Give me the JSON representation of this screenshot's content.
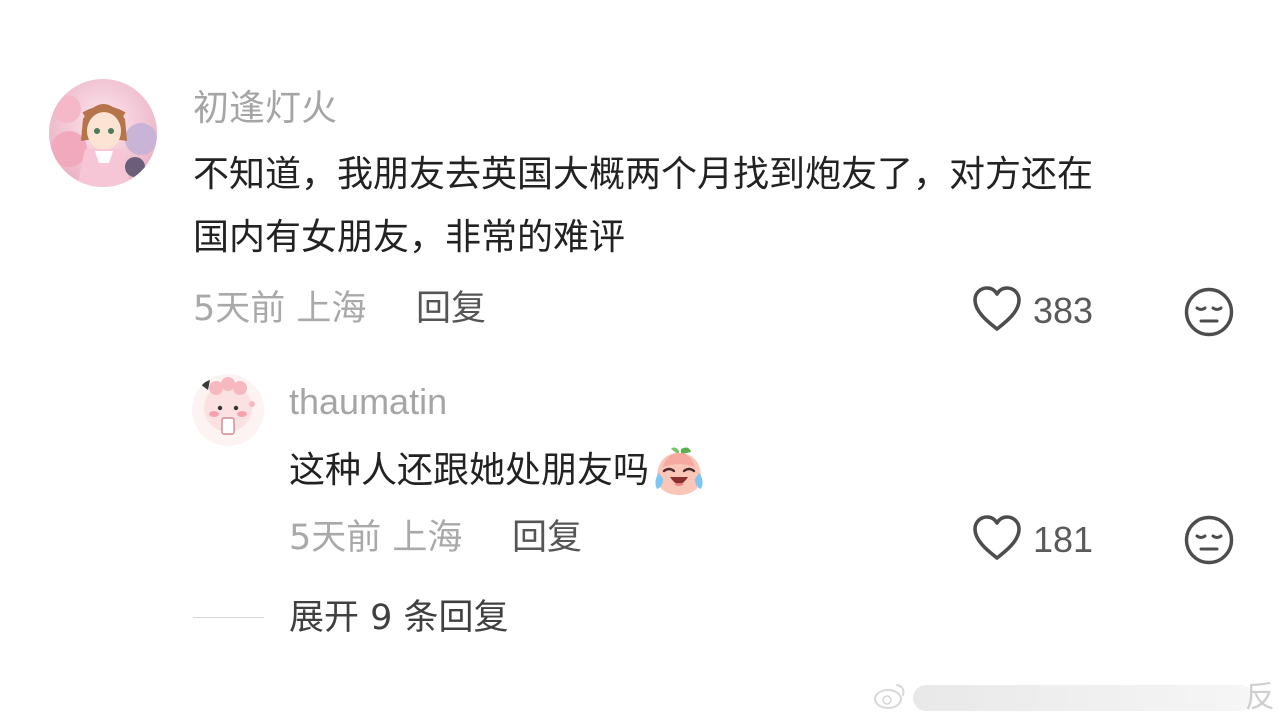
{
  "comments": [
    {
      "username": "初逢灯火",
      "text_lines": [
        "不知道，我朋友去英国大概两个月找到炮友了，对方还在",
        "国内有女朋友，非常的难评"
      ],
      "meta": "5天前 上海",
      "reply_label": "回复",
      "likes": "383"
    }
  ],
  "reply": {
    "username": "thaumatin",
    "text": "这种人还跟她处朋友吗",
    "emoji": "laughing-crying-peach-emoji",
    "meta": "5天前 上海",
    "reply_label": "回复",
    "likes": "181"
  },
  "expand_label": "展开 9 条回复",
  "watermark_text": "反",
  "icons": {
    "like": "heart-outline-icon",
    "dislike": "meh-face-icon",
    "watermark": "weibo-logo-icon"
  },
  "colors": {
    "background": "#ffffff",
    "username": "#a5a5a5",
    "text": "#222222",
    "meta": "#a9a9a9",
    "reply_button": "#555555",
    "icon": "#4d4d4d"
  }
}
